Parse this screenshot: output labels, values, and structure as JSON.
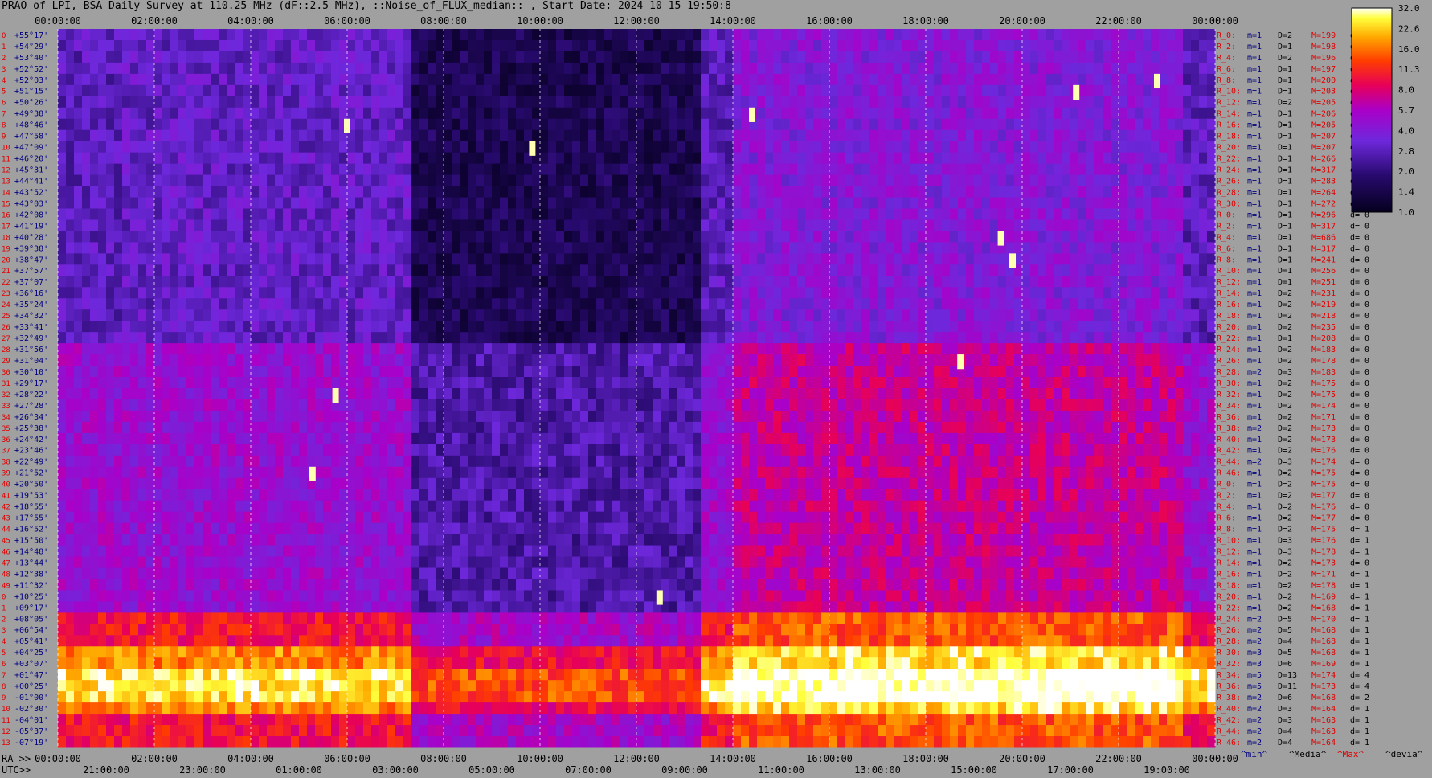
{
  "title": "PRAO of LPI, BSA Daily Survey at 110.25 MHz (dF::2.5 MHz), ::Noise_of_FLUX_median:: , Start Date: 2024 10 15 19:50:8",
  "colors": {
    "background": "#a0a0a0",
    "label_red": "#e00000",
    "label_blue": "#000080"
  },
  "chart_data": {
    "type": "heatmap",
    "title": "PRAO of LPI, BSA Daily Survey at 110.25 MHz (dF::2.5 MHz), ::Noise_of_FLUX_median:: , Start Date: 2024 10 15 19:50:8",
    "x_ra_ticks": [
      "00:00:00",
      "02:00:00",
      "04:00:00",
      "06:00:00",
      "08:00:00",
      "10:00:00",
      "12:00:00",
      "14:00:00",
      "16:00:00",
      "18:00:00",
      "20:00:00",
      "22:00:00",
      "00:00:00"
    ],
    "x_ra_label": "RA >>",
    "x_utc_ticks": [
      "21:00:00",
      "23:00:00",
      "01:00:00",
      "03:00:00",
      "05:00:00",
      "07:00:00",
      "09:00:00",
      "11:00:00",
      "13:00:00",
      "15:00:00",
      "17:00:00",
      "19:00:00"
    ],
    "x_utc_label": "UTC>>",
    "y_dec_ticks": [
      "+55°17'",
      "+54°29'",
      "+53°40'",
      "+52°52'",
      "+52°03'",
      "+51°15'",
      "+50°26'",
      "+49°38'",
      "+48°46'",
      "+47°58'",
      "+47°09'",
      "+46°20'",
      "+45°31'",
      "+44°41'",
      "+43°52'",
      "+43°03'",
      "+42°08'",
      "+41°19'",
      "+40°28'",
      "+39°38'",
      "+38°47'",
      "+37°57'",
      "+37°07'",
      "+36°16'",
      "+35°24'",
      "+34°32'",
      "+33°41'",
      "+32°49'",
      "+31°56'",
      "+31°04'",
      "+30°10'",
      "+29°17'",
      "+28°22'",
      "+27°28'",
      "+26°34'",
      "+25°38'",
      "+24°42'",
      "+23°46'",
      "+22°49'",
      "+21°52'",
      "+20°50'",
      "+19°53'",
      "+18°55'",
      "+17°55'",
      "+16°52'",
      "+15°50'",
      "+14°48'",
      "+13°44'",
      "+12°38'",
      "+11°32'",
      "+10°25'",
      "+09°17'",
      "+08°05'",
      "+06°54'",
      "+05°41'",
      "+04°25'",
      "+03°07'",
      "+01°47'",
      "+00°25'",
      "-01°00'",
      "-02°30'",
      "-04°01'",
      "-05°37'",
      "-07°19'"
    ],
    "colorbar": {
      "labels": [
        "32.0",
        "22.6",
        "16.0",
        "11.3",
        "8.0",
        "5.7",
        "4.0",
        "2.8",
        "2.0",
        "1.4",
        "1.0"
      ],
      "range": [
        1.0,
        32.0
      ],
      "scale": "log"
    },
    "row_stats": [
      {
        "R": "R_0:",
        "m": "m=1",
        "D": "D=2",
        "M": "M=199",
        "d": "d= 0"
      },
      {
        "R": "R_2:",
        "m": "m=1",
        "D": "D=1",
        "M": "M=198",
        "d": "d= 0"
      },
      {
        "R": "R_4:",
        "m": "m=1",
        "D": "D=2",
        "M": "M=196",
        "d": "d= 0"
      },
      {
        "R": "R_6:",
        "m": "m=1",
        "D": "D=1",
        "M": "M=197",
        "d": "d= 0"
      },
      {
        "R": "R_8:",
        "m": "m=1",
        "D": "D=1",
        "M": "M=200",
        "d": "d= 0"
      },
      {
        "R": "R_10:",
        "m": "m=1",
        "D": "D=1",
        "M": "M=203",
        "d": "d="
      },
      {
        "R": "R_12:",
        "m": "m=1",
        "D": "D=2",
        "M": "M=205",
        "d": "d="
      },
      {
        "R": "R_14:",
        "m": "m=1",
        "D": "D=1",
        "M": "M=206",
        "d": "d="
      },
      {
        "R": "R_16:",
        "m": "m=1",
        "D": "D=1",
        "M": "M=205",
        "d": "d="
      },
      {
        "R": "R_18:",
        "m": "m=1",
        "D": "D=1",
        "M": "M=207",
        "d": "d="
      },
      {
        "R": "R_20:",
        "m": "m=1",
        "D": "D=1",
        "M": "M=207",
        "d": "d="
      },
      {
        "R": "R_22:",
        "m": "m=1",
        "D": "D=1",
        "M": "M=266",
        "d": "d="
      },
      {
        "R": "R_24:",
        "m": "m=1",
        "D": "D=1",
        "M": "M=317",
        "d": "d="
      },
      {
        "R": "R_26:",
        "m": "m=1",
        "D": "D=1",
        "M": "M=283",
        "d": "d="
      },
      {
        "R": "R_28:",
        "m": "m=1",
        "D": "D=1",
        "M": "M=264",
        "d": "d="
      },
      {
        "R": "R_30:",
        "m": "m=1",
        "D": "D=1",
        "M": "M=272",
        "d": "d="
      },
      {
        "R": "R_0:",
        "m": "m=1",
        "D": "D=1",
        "M": "M=296",
        "d": "d= 0"
      },
      {
        "R": "R_2:",
        "m": "m=1",
        "D": "D=1",
        "M": "M=317",
        "d": "d= 0"
      },
      {
        "R": "R_4:",
        "m": "m=1",
        "D": "D=1",
        "M": "M=686",
        "d": "d= 0"
      },
      {
        "R": "R_6:",
        "m": "m=1",
        "D": "D=1",
        "M": "M=317",
        "d": "d= 0"
      },
      {
        "R": "R_8:",
        "m": "m=1",
        "D": "D=1",
        "M": "M=241",
        "d": "d= 0"
      },
      {
        "R": "R_10:",
        "m": "m=1",
        "D": "D=1",
        "M": "M=256",
        "d": "d= 0"
      },
      {
        "R": "R_12:",
        "m": "m=1",
        "D": "D=1",
        "M": "M=251",
        "d": "d= 0"
      },
      {
        "R": "R_14:",
        "m": "m=1",
        "D": "D=2",
        "M": "M=231",
        "d": "d= 0"
      },
      {
        "R": "R_16:",
        "m": "m=1",
        "D": "D=2",
        "M": "M=219",
        "d": "d= 0"
      },
      {
        "R": "R_18:",
        "m": "m=1",
        "D": "D=2",
        "M": "M=218",
        "d": "d= 0"
      },
      {
        "R": "R_20:",
        "m": "m=1",
        "D": "D=2",
        "M": "M=235",
        "d": "d= 0"
      },
      {
        "R": "R_22:",
        "m": "m=1",
        "D": "D=1",
        "M": "M=208",
        "d": "d= 0"
      },
      {
        "R": "R_24:",
        "m": "m=1",
        "D": "D=2",
        "M": "M=183",
        "d": "d= 0"
      },
      {
        "R": "R_26:",
        "m": "m=1",
        "D": "D=2",
        "M": "M=178",
        "d": "d= 0"
      },
      {
        "R": "R_28:",
        "m": "m=2",
        "D": "D=3",
        "M": "M=183",
        "d": "d= 0"
      },
      {
        "R": "R_30:",
        "m": "m=1",
        "D": "D=2",
        "M": "M=175",
        "d": "d= 0"
      },
      {
        "R": "R_32:",
        "m": "m=1",
        "D": "D=2",
        "M": "M=175",
        "d": "d= 0"
      },
      {
        "R": "R_34:",
        "m": "m=1",
        "D": "D=2",
        "M": "M=174",
        "d": "d= 0"
      },
      {
        "R": "R_36:",
        "m": "m=1",
        "D": "D=2",
        "M": "M=171",
        "d": "d= 0"
      },
      {
        "R": "R_38:",
        "m": "m=2",
        "D": "D=2",
        "M": "M=173",
        "d": "d= 0"
      },
      {
        "R": "R_40:",
        "m": "m=1",
        "D": "D=2",
        "M": "M=173",
        "d": "d= 0"
      },
      {
        "R": "R_42:",
        "m": "m=1",
        "D": "D=2",
        "M": "M=176",
        "d": "d= 0"
      },
      {
        "R": "R_44:",
        "m": "m=2",
        "D": "D=3",
        "M": "M=174",
        "d": "d= 0"
      },
      {
        "R": "R_46:",
        "m": "m=1",
        "D": "D=2",
        "M": "M=175",
        "d": "d= 0"
      },
      {
        "R": "R_0:",
        "m": "m=1",
        "D": "D=2",
        "M": "M=175",
        "d": "d= 0"
      },
      {
        "R": "R_2:",
        "m": "m=1",
        "D": "D=2",
        "M": "M=177",
        "d": "d= 0"
      },
      {
        "R": "R_4:",
        "m": "m=1",
        "D": "D=2",
        "M": "M=176",
        "d": "d= 0"
      },
      {
        "R": "R_6:",
        "m": "m=1",
        "D": "D=2",
        "M": "M=177",
        "d": "d= 0"
      },
      {
        "R": "R_8:",
        "m": "m=1",
        "D": "D=2",
        "M": "M=175",
        "d": "d= 1"
      },
      {
        "R": "R_10:",
        "m": "m=1",
        "D": "D=3",
        "M": "M=176",
        "d": "d= 1"
      },
      {
        "R": "R_12:",
        "m": "m=1",
        "D": "D=3",
        "M": "M=178",
        "d": "d= 1"
      },
      {
        "R": "R_14:",
        "m": "m=1",
        "D": "D=2",
        "M": "M=173",
        "d": "d= 0"
      },
      {
        "R": "R_16:",
        "m": "m=1",
        "D": "D=2",
        "M": "M=171",
        "d": "d= 1"
      },
      {
        "R": "R_18:",
        "m": "m=1",
        "D": "D=2",
        "M": "M=178",
        "d": "d= 1"
      },
      {
        "R": "R_20:",
        "m": "m=1",
        "D": "D=2",
        "M": "M=169",
        "d": "d= 1"
      },
      {
        "R": "R_22:",
        "m": "m=1",
        "D": "D=2",
        "M": "M=168",
        "d": "d= 1"
      },
      {
        "R": "R_24:",
        "m": "m=2",
        "D": "D=5",
        "M": "M=170",
        "d": "d= 1"
      },
      {
        "R": "R_26:",
        "m": "m=2",
        "D": "D=5",
        "M": "M=168",
        "d": "d= 1"
      },
      {
        "R": "R_28:",
        "m": "m=2",
        "D": "D=4",
        "M": "M=168",
        "d": "d= 1"
      },
      {
        "R": "R_30:",
        "m": "m=3",
        "D": "D=5",
        "M": "M=168",
        "d": "d= 1"
      },
      {
        "R": "R_32:",
        "m": "m=3",
        "D": "D=6",
        "M": "M=169",
        "d": "d= 1"
      },
      {
        "R": "R_34:",
        "m": "m=5",
        "D": "D=13",
        "M": "M=174",
        "d": "d= 4"
      },
      {
        "R": "R_36:",
        "m": "m=5",
        "D": "D=11",
        "M": "M=173",
        "d": "d= 4"
      },
      {
        "R": "R_38:",
        "m": "m=2",
        "D": "D=6",
        "M": "M=168",
        "d": "d= 2"
      },
      {
        "R": "R_40:",
        "m": "m=2",
        "D": "D=3",
        "M": "M=164",
        "d": "d= 1"
      },
      {
        "R": "R_42:",
        "m": "m=2",
        "D": "D=3",
        "M": "M=163",
        "d": "d= 1"
      },
      {
        "R": "R_44:",
        "m": "m=2",
        "D": "D=4",
        "M": "M=163",
        "d": "d= 1"
      },
      {
        "R": "R_46:",
        "m": "m=2",
        "D": "D=4",
        "M": "M=164",
        "d": "d= 1"
      }
    ],
    "legend": [
      "^min^",
      "^Media^",
      "^Max^",
      "^devia^"
    ]
  }
}
